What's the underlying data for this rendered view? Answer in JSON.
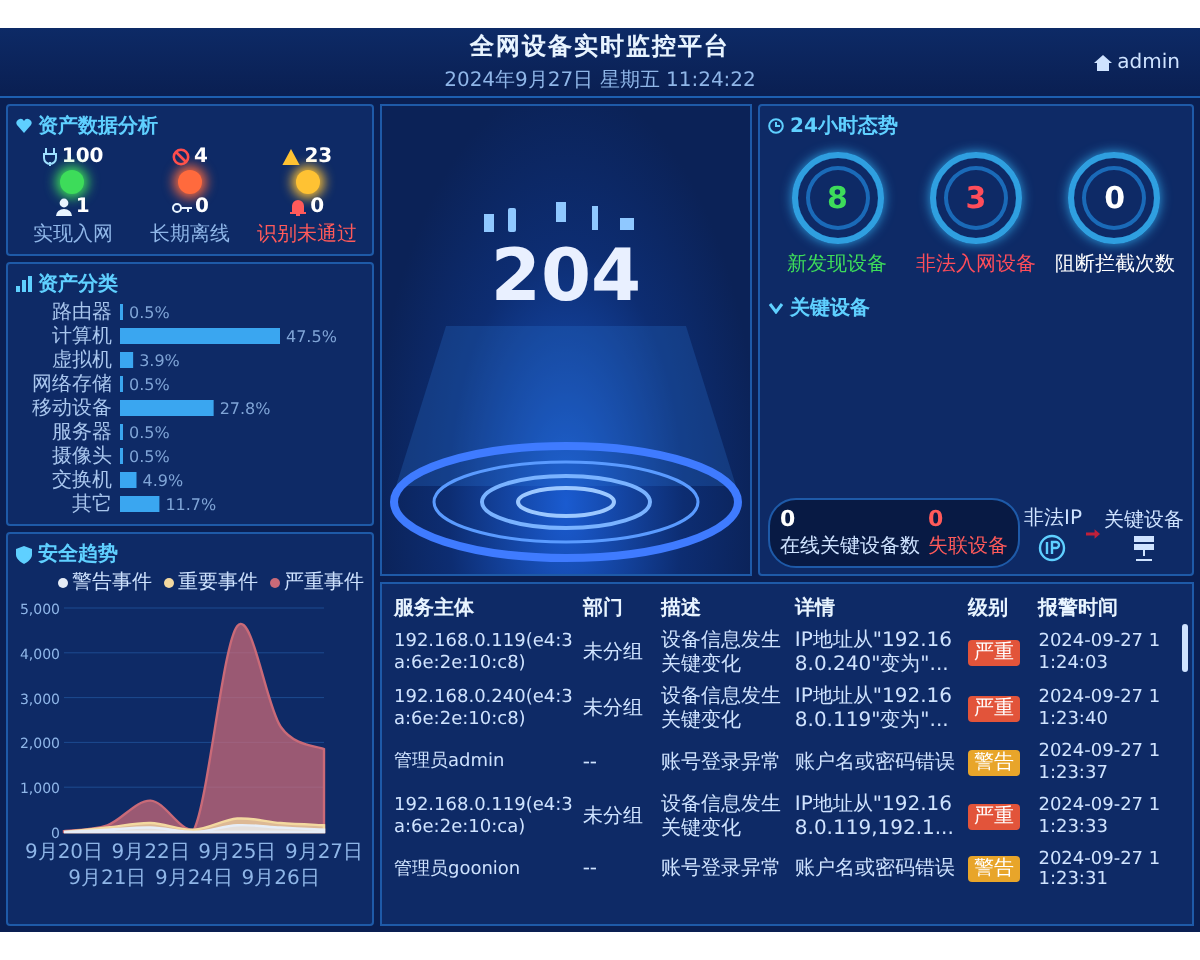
{
  "header": {
    "title": "全网设备实时监控平台",
    "datetime": "2024年9月27日 星期五 11:24:22",
    "user": "admin"
  },
  "asset_analysis": {
    "title": "资产数据分析",
    "items": [
      {
        "kind": "online",
        "top_value": "100",
        "bottom_value": "1",
        "label": "实现入网",
        "color": "#3ddc5a",
        "alert": false
      },
      {
        "kind": "offline",
        "top_value": "4",
        "bottom_value": "0",
        "label": "长期离线",
        "color": "#ff6a3d",
        "alert": false
      },
      {
        "kind": "unidentified",
        "top_value": "23",
        "bottom_value": "0",
        "label": "识别未通过",
        "color": "#ffc233",
        "alert": true
      }
    ]
  },
  "asset_categories": {
    "title": "资产分类",
    "chart_data": {
      "type": "bar",
      "orientation": "horizontal",
      "categories": [
        "路由器",
        "计算机",
        "虚拟机",
        "网络存储",
        "移动设备",
        "服务器",
        "摄像头",
        "交换机",
        "其它"
      ],
      "values": [
        0.5,
        47.5,
        3.9,
        0.5,
        27.8,
        0.5,
        0.5,
        4.9,
        11.7
      ],
      "value_labels": [
        "0.5%",
        "47.5%",
        "3.9%",
        "0.5%",
        "27.8%",
        "0.5%",
        "0.5%",
        "4.9%",
        "11.7%"
      ]
    }
  },
  "security_trend": {
    "title": "安全趋势",
    "chart_data": {
      "type": "area",
      "grid": true,
      "x": [
        "9月20日",
        "9月21日",
        "9月22日",
        "9月24日",
        "9月25日",
        "9月26日",
        "9月27日"
      ],
      "ylim": [
        0,
        5000
      ],
      "yticks": [
        0,
        {
          "value": 1000,
          "label": "1,000"
        },
        {
          "value": 2000,
          "label": "2,000"
        },
        {
          "value": 3000,
          "label": "3,000"
        },
        {
          "value": 4000,
          "label": "4,000"
        },
        {
          "value": 5000,
          "label": "5,000"
        }
      ],
      "series": [
        {
          "name": "警告事件",
          "color": "#e6edf7",
          "values": [
            0,
            50,
            100,
            0,
            150,
            100,
            50
          ]
        },
        {
          "name": "重要事件",
          "color": "#f3d9a0",
          "values": [
            0,
            100,
            200,
            50,
            300,
            200,
            150
          ]
        },
        {
          "name": "严重事件",
          "color": "#c96a78",
          "values": [
            20,
            150,
            700,
            50,
            4600,
            2350,
            1850
          ]
        }
      ]
    }
  },
  "device_count": "204",
  "trend_24h": {
    "title": "24小时态势",
    "items": [
      {
        "value": "8",
        "label": "新发现设备",
        "color": "#3ddc5a"
      },
      {
        "value": "3",
        "label": "非法入网设备",
        "color": "#ff4d5a"
      },
      {
        "value": "0",
        "label": "阻断拦截次数",
        "color": "#ffffff"
      }
    ]
  },
  "key_devices": {
    "title": "关键设备",
    "online": {
      "value": "0",
      "label": "在线关键设备数"
    },
    "lost": {
      "value": "0",
      "label": "失联设备"
    },
    "illegal_ip": {
      "label": "非法IP"
    },
    "target": {
      "label": "关键设备"
    }
  },
  "alerts": {
    "columns": [
      "服务主体",
      "部门",
      "描述",
      "详情",
      "级别",
      "报警时间"
    ],
    "rows": [
      {
        "kind": "severe",
        "cells": [
          "192.168.0.119(e4:3a:6e:2e:10:c8)",
          "未分组",
          "设备信息发生关键变化",
          "IP地址从\"192.168.0.240\"变为\"...",
          "严重",
          "2024-09-27 11:24:03"
        ]
      },
      {
        "kind": "severe",
        "cells": [
          "192.168.0.240(e4:3a:6e:2e:10:c8)",
          "未分组",
          "设备信息发生关键变化",
          "IP地址从\"192.168.0.119\"变为\"...",
          "严重",
          "2024-09-27 11:23:40"
        ]
      },
      {
        "kind": "warning",
        "cells": [
          "管理员admin",
          "--",
          "账号登录异常",
          "账户名或密码错误",
          "警告",
          "2024-09-27 11:23:37"
        ]
      },
      {
        "kind": "severe",
        "cells": [
          "192.168.0.119(e4:3a:6e:2e:10:ca)",
          "未分组",
          "设备信息发生关键变化",
          "IP地址从\"192.168.0.119,192.1...",
          "严重",
          "2024-09-27 11:23:33"
        ]
      },
      {
        "kind": "warning",
        "cells": [
          "管理员goonion",
          "--",
          "账号登录异常",
          "账户名或密码错误",
          "警告",
          "2024-09-27 11:23:31"
        ]
      }
    ]
  }
}
